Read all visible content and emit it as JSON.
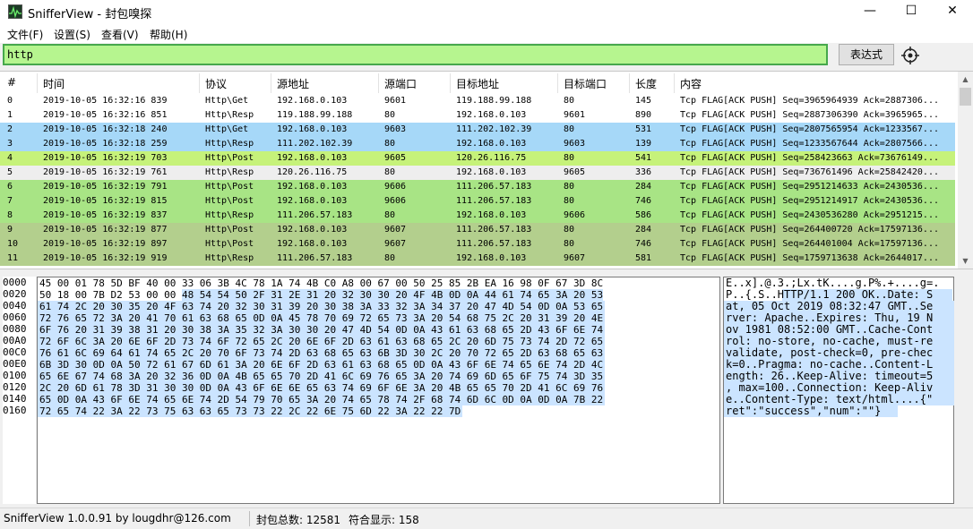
{
  "window": {
    "title": "SnifferView - 封包嗅探",
    "minimize": "—",
    "maximize": "☐",
    "close": "✕",
    "app_icon": "sniffer-app-icon"
  },
  "menu": [
    "文件(F)",
    "设置(S)",
    "查看(V)",
    "帮助(H)"
  ],
  "filter": {
    "value": "http",
    "expression_button": "表达式",
    "target_icon": "crosshair-icon"
  },
  "columns": [
    "#",
    "时间",
    "协议",
    "源地址",
    "源端口",
    "目标地址",
    "目标端口",
    "长度",
    "内容"
  ],
  "packets": [
    {
      "id": "0",
      "time": "2019-10-05 16:32:16 839",
      "proto": "Http\\Get",
      "src": "192.168.0.103",
      "sport": "9601",
      "dst": "119.188.99.188",
      "dport": "80",
      "len": "145",
      "info": "Tcp FLAG[ACK PUSH] Seq=3965964939 Ack=2887306...",
      "color": "#ffffff"
    },
    {
      "id": "1",
      "time": "2019-10-05 16:32:16 851",
      "proto": "Http\\Resp",
      "src": "119.188.99.188",
      "sport": "80",
      "dst": "192.168.0.103",
      "dport": "9601",
      "len": "890",
      "info": "Tcp FLAG[ACK PUSH] Seq=2887306390 Ack=3965965...",
      "color": "#ffffff"
    },
    {
      "id": "2",
      "time": "2019-10-05 16:32:18 240",
      "proto": "Http\\Get",
      "src": "192.168.0.103",
      "sport": "9603",
      "dst": "111.202.102.39",
      "dport": "80",
      "len": "531",
      "info": "Tcp FLAG[ACK PUSH] Seq=2807565954 Ack=1233567...",
      "color": "#a6d8f8"
    },
    {
      "id": "3",
      "time": "2019-10-05 16:32:18 259",
      "proto": "Http\\Resp",
      "src": "111.202.102.39",
      "sport": "80",
      "dst": "192.168.0.103",
      "dport": "9603",
      "len": "139",
      "info": "Tcp FLAG[ACK PUSH] Seq=1233567644 Ack=2807566...",
      "color": "#a6d8f8"
    },
    {
      "id": "4",
      "time": "2019-10-05 16:32:19 703",
      "proto": "Http\\Post",
      "src": "192.168.0.103",
      "sport": "9605",
      "dst": "120.26.116.75",
      "dport": "80",
      "len": "541",
      "info": "Tcp FLAG[ACK PUSH] Seq=258423663 Ack=73676149...",
      "color": "#c6f27a"
    },
    {
      "id": "5",
      "time": "2019-10-05 16:32:19 761",
      "proto": "Http\\Resp",
      "src": "120.26.116.75",
      "sport": "80",
      "dst": "192.168.0.103",
      "dport": "9605",
      "len": "336",
      "info": "Tcp FLAG[ACK PUSH] Seq=736761496 Ack=25842420...",
      "color": "#eeeeee"
    },
    {
      "id": "6",
      "time": "2019-10-05 16:32:19 791",
      "proto": "Http\\Post",
      "src": "192.168.0.103",
      "sport": "9606",
      "dst": "111.206.57.183",
      "dport": "80",
      "len": "284",
      "info": "Tcp FLAG[ACK PUSH] Seq=2951214633 Ack=2430536...",
      "color": "#a8e485"
    },
    {
      "id": "7",
      "time": "2019-10-05 16:32:19 815",
      "proto": "Http\\Post",
      "src": "192.168.0.103",
      "sport": "9606",
      "dst": "111.206.57.183",
      "dport": "80",
      "len": "746",
      "info": "Tcp FLAG[ACK PUSH] Seq=2951214917 Ack=2430536...",
      "color": "#a8e485"
    },
    {
      "id": "8",
      "time": "2019-10-05 16:32:19 837",
      "proto": "Http\\Resp",
      "src": "111.206.57.183",
      "sport": "80",
      "dst": "192.168.0.103",
      "dport": "9606",
      "len": "586",
      "info": "Tcp FLAG[ACK PUSH] Seq=2430536280 Ack=2951215...",
      "color": "#a8e485"
    },
    {
      "id": "9",
      "time": "2019-10-05 16:32:19 877",
      "proto": "Http\\Post",
      "src": "192.168.0.103",
      "sport": "9607",
      "dst": "111.206.57.183",
      "dport": "80",
      "len": "284",
      "info": "Tcp FLAG[ACK PUSH] Seq=264400720 Ack=17597136...",
      "color": "#b3cf8d"
    },
    {
      "id": "10",
      "time": "2019-10-05 16:32:19 897",
      "proto": "Http\\Post",
      "src": "192.168.0.103",
      "sport": "9607",
      "dst": "111.206.57.183",
      "dport": "80",
      "len": "746",
      "info": "Tcp FLAG[ACK PUSH] Seq=264401004 Ack=17597136...",
      "color": "#b3cf8d"
    },
    {
      "id": "11",
      "time": "2019-10-05 16:32:19 919",
      "proto": "Http\\Resp",
      "src": "111.206.57.183",
      "sport": "80",
      "dst": "192.168.0.103",
      "dport": "9607",
      "len": "581",
      "info": "Tcp FLAG[ACK PUSH] Seq=1759713638 Ack=2644017...",
      "color": "#b3cf8d"
    }
  ],
  "hex": {
    "offsets": [
      "0000",
      "0020",
      "0040",
      "0060",
      "0080",
      "00A0",
      "00C0",
      "00E0",
      "0100",
      "0120",
      "0140",
      "0160"
    ],
    "lines": [
      "45 00 01 78 5D BF 40 00 33 06 3B 4C 78 1A 74 4B C0 A8 00 67 00 50 25 85 2B EA 16 98 0F 67 3D 8C",
      "50 18 00 7B D2 53 00 00 48 54 54 50 2F 31 2E 31 20 32 30 30 20 4F 4B 0D 0A 44 61 74 65 3A 20 53",
      "61 74 2C 20 30 35 20 4F 63 74 20 32 30 31 39 20 30 38 3A 33 32 3A 34 37 20 47 4D 54 0D 0A 53 65",
      "72 76 65 72 3A 20 41 70 61 63 68 65 0D 0A 45 78 70 69 72 65 73 3A 20 54 68 75 2C 20 31 39 20 4E",
      "6F 76 20 31 39 38 31 20 30 38 3A 35 32 3A 30 30 20 47 4D 54 0D 0A 43 61 63 68 65 2D 43 6F 6E 74",
      "72 6F 6C 3A 20 6E 6F 2D 73 74 6F 72 65 2C 20 6E 6F 2D 63 61 63 68 65 2C 20 6D 75 73 74 2D 72 65",
      "76 61 6C 69 64 61 74 65 2C 20 70 6F 73 74 2D 63 68 65 63 6B 3D 30 2C 20 70 72 65 2D 63 68 65 63",
      "6B 3D 30 0D 0A 50 72 61 67 6D 61 3A 20 6E 6F 2D 63 61 63 68 65 0D 0A 43 6F 6E 74 65 6E 74 2D 4C",
      "65 6E 67 74 68 3A 20 32 36 0D 0A 4B 65 65 70 2D 41 6C 69 76 65 3A 20 74 69 6D 65 6F 75 74 3D 35",
      "2C 20 6D 61 78 3D 31 30 30 0D 0A 43 6F 6E 6E 65 63 74 69 6F 6E 3A 20 4B 65 65 70 2D 41 6C 69 76",
      "65 0D 0A 43 6F 6E 74 65 6E 74 2D 54 79 70 65 3A 20 74 65 78 74 2F 68 74 6D 6C 0D 0A 0D 0A 7B 22",
      "72 65 74 22 3A 22 73 75 63 63 65 73 73 22 2C 22 6E 75 6D 22 3A 22 22 7D"
    ],
    "ascii": [
      "E..x].@.3.;Lx.tK....g.P%.+....g=.",
      "P..{.S..HTTP/1.1 200 OK..Date: S",
      "at, 05 Oct 2019 08:32:47 GMT..Se",
      "rver: Apache..Expires: Thu, 19 N",
      "ov 1981 08:52:00 GMT..Cache-Cont",
      "rol: no-store, no-cache, must-re",
      "validate, post-check=0, pre-chec",
      "k=0..Pragma: no-cache..Content-L",
      "ength: 26..Keep-Alive: timeout=5",
      ", max=100..Connection: Keep-Aliv",
      "e..Content-Type: text/html....{\"",
      "ret\":\"success\",\"num\":\"\"}"
    ]
  },
  "status": {
    "app": "SnifferView  1.0.0.91   by  lougdhr@126.com",
    "total": "封包总数:  12581",
    "matched": "符合显示:  158"
  },
  "colors": {
    "filter_bg": "#b6f58f",
    "filter_border": "#46a84c",
    "hex_highlight": "#cbe4ff"
  }
}
